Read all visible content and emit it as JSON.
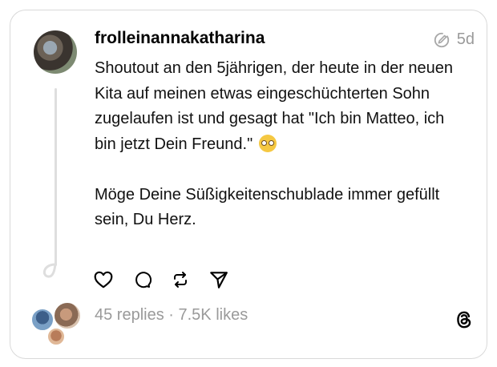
{
  "post": {
    "username": "frolleinannakatharina",
    "time": "5d",
    "edited_icon": "edited-pencil-circle-icon",
    "paragraphs": [
      "Shoutout an den 5jährigen, der heute in der neuen Kita auf meinen etwas eingeschüchterten Sohn zugelaufen ist und gesagt hat \"Ich bin Matteo, ich bin jetzt Dein Freund.\"",
      "Möge Deine Süßigkeitenschublade immer gefüllt sein, Du Herz."
    ],
    "emoji": "pleading-face-emoji"
  },
  "actions": [
    "heart-icon",
    "comment-icon",
    "repost-icon",
    "share-icon"
  ],
  "stats": "45 replies · 7.5K likes",
  "brand": "threads-logo"
}
